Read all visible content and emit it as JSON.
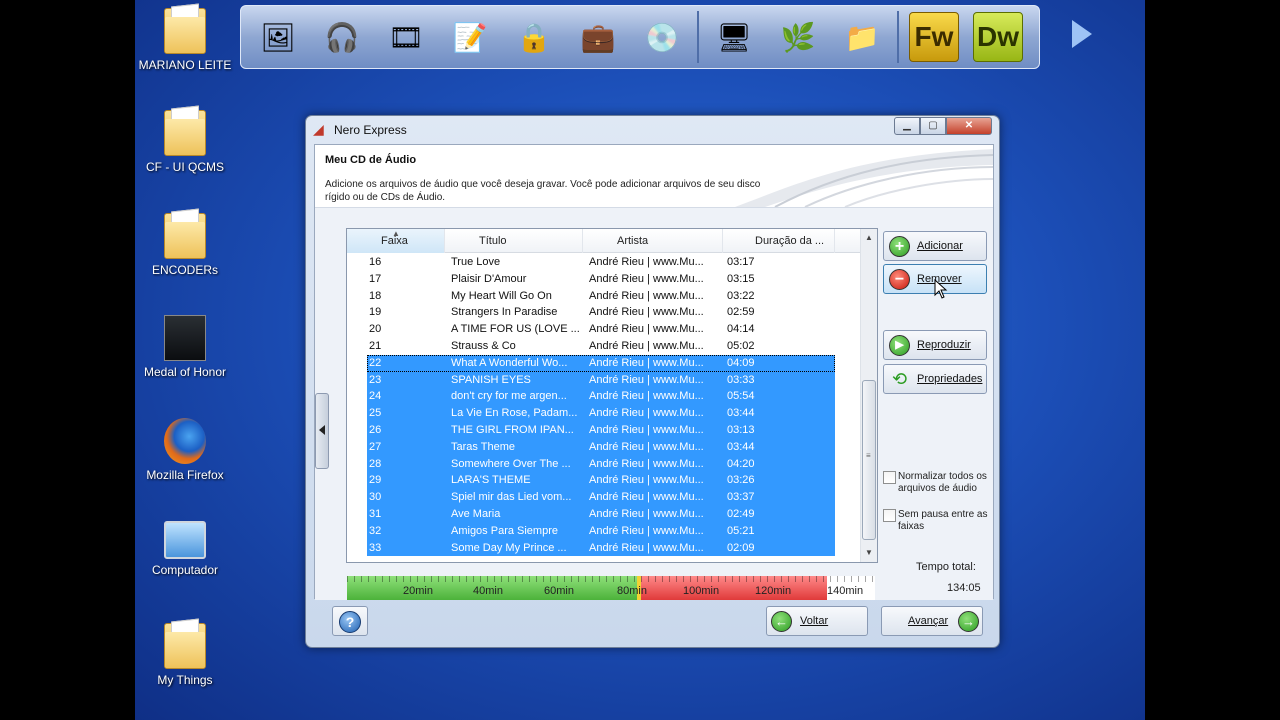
{
  "desktop_icons": [
    {
      "label": "MARIANO LEITE",
      "type": "folder"
    },
    {
      "label": "CF - UI QCMS",
      "type": "folder"
    },
    {
      "label": "ENCODERs",
      "type": "folder"
    },
    {
      "label": "Medal of Honor",
      "type": "shortcut"
    },
    {
      "label": "Mozilla Firefox",
      "type": "shortcut"
    },
    {
      "label": "Computador",
      "type": "computer"
    },
    {
      "label": "My Things",
      "type": "folder"
    }
  ],
  "dock": {
    "fw_label": "Fw",
    "dw_label": "Dw"
  },
  "window": {
    "title": "Nero Express",
    "header_title": "Meu CD de Áudio",
    "header_desc": "Adicione os arquivos de áudio que você deseja gravar. Você pode adicionar arquivos de seu disco rígido ou de CDs de Áudio."
  },
  "list": {
    "columns": [
      "Faixa",
      "Título",
      "Artista",
      "Duração da ..."
    ],
    "rows": [
      {
        "num": "16",
        "title": "True Love",
        "artist": "André Rieu | www.Mu...",
        "dur": "03:17",
        "selected": false
      },
      {
        "num": "17",
        "title": "Plaisir D'Amour",
        "artist": "André Rieu | www.Mu...",
        "dur": "03:15",
        "selected": false
      },
      {
        "num": "18",
        "title": "My Heart Will Go On",
        "artist": "André Rieu | www.Mu...",
        "dur": "03:22",
        "selected": false
      },
      {
        "num": "19",
        "title": "Strangers In Paradise",
        "artist": "André Rieu | www.Mu...",
        "dur": "02:59",
        "selected": false
      },
      {
        "num": "20",
        "title": "A TIME FOR US (LOVE ...",
        "artist": "André Rieu | www.Mu...",
        "dur": "04:14",
        "selected": false
      },
      {
        "num": "21",
        "title": "Strauss & Co",
        "artist": "André Rieu | www.Mu...",
        "dur": "05:02",
        "selected": false
      },
      {
        "num": "22",
        "title": "What A Wonderful Wo...",
        "artist": "André Rieu | www.Mu...",
        "dur": "04:09",
        "selected": true
      },
      {
        "num": "23",
        "title": "SPANISH EYES",
        "artist": "André Rieu | www.Mu...",
        "dur": "03:33",
        "selected": true
      },
      {
        "num": "24",
        "title": "don't cry for me argen...",
        "artist": "André Rieu | www.Mu...",
        "dur": "05:54",
        "selected": true
      },
      {
        "num": "25",
        "title": "La Vie En Rose, Padam...",
        "artist": "André Rieu | www.Mu...",
        "dur": "03:44",
        "selected": true
      },
      {
        "num": "26",
        "title": "THE GIRL FROM IPAN...",
        "artist": "André Rieu | www.Mu...",
        "dur": "03:13",
        "selected": true
      },
      {
        "num": "27",
        "title": "Taras Theme",
        "artist": "André Rieu | www.Mu...",
        "dur": "03:44",
        "selected": true
      },
      {
        "num": "28",
        "title": "Somewhere Over The ...",
        "artist": "André Rieu | www.Mu...",
        "dur": "04:20",
        "selected": true
      },
      {
        "num": "29",
        "title": "LARA'S THEME",
        "artist": "André Rieu | www.Mu...",
        "dur": "03:26",
        "selected": true
      },
      {
        "num": "30",
        "title": "Spiel mir das Lied vom...",
        "artist": "André Rieu | www.Mu...",
        "dur": "03:37",
        "selected": true
      },
      {
        "num": "31",
        "title": "Ave Maria",
        "artist": "André Rieu | www.Mu...",
        "dur": "02:49",
        "selected": true
      },
      {
        "num": "32",
        "title": "Amigos Para Siempre",
        "artist": "André Rieu | www.Mu...",
        "dur": "05:21",
        "selected": true
      },
      {
        "num": "33",
        "title": "Some Day My Prince ...",
        "artist": "André Rieu | www.Mu...",
        "dur": "02:09",
        "selected": true
      }
    ]
  },
  "capacity": {
    "labels": [
      "20min",
      "40min",
      "60min",
      "80min",
      "100min",
      "120min",
      "140min"
    ],
    "colors": {
      "green": "#5fc84a",
      "yellow": "#f2d233",
      "red": "#e8464a"
    }
  },
  "buttons": {
    "add": "Adicionar",
    "remove": "Remover",
    "play": "Reproduzir",
    "properties": "Propriedades",
    "back": "Voltar",
    "next": "Avançar",
    "help": "?"
  },
  "options": {
    "normalize": "Normalizar todos os arquivos de áudio",
    "no_pause": "Sem pausa entre as faixas"
  },
  "total": {
    "label": "Tempo total:",
    "value": "134:05"
  }
}
